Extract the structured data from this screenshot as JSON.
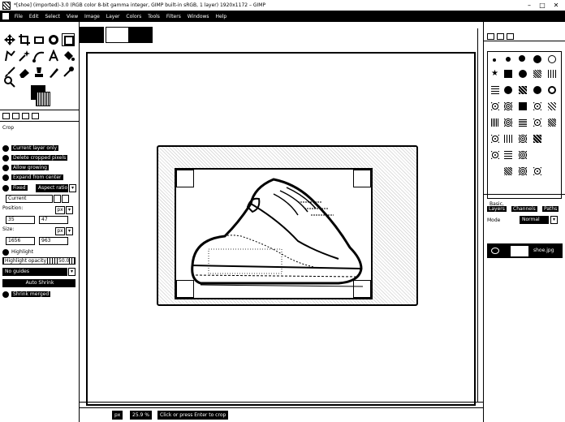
{
  "window": {
    "title": "*[shoe] (imported)-3.0 (RGB color 8-bit gamma integer, GIMP built-in sRGB, 1 layer) 1920x1172 – GIMP",
    "minimize": "–",
    "maximize": "□",
    "close": "✕"
  },
  "menu": [
    "File",
    "Edit",
    "Select",
    "View",
    "Image",
    "Layer",
    "Colors",
    "Tools",
    "Filters",
    "Windows",
    "Help"
  ],
  "tool_options": {
    "title": "Crop",
    "current_layer_only": "Current layer only",
    "delete_cropped": "Delete cropped pixels",
    "allow_growing": "Allow growing",
    "expand_from_center": "Expand from center",
    "fixed_label": "Fixed",
    "fixed_value": "Aspect ratio",
    "current_value": "Current",
    "position_label": "Position:",
    "position_x": "35",
    "position_y": "47",
    "position_unit": "px",
    "size_label": "Size:",
    "size_w": "1656",
    "size_h": "963",
    "size_unit": "px",
    "highlight_label": "Highlight",
    "highlight_opacity_label": "Highlight opacity",
    "highlight_opacity_value": "50.0",
    "guides_value": "No guides",
    "auto_shrink": "Auto Shrink",
    "shrink_merged": "Shrink merged"
  },
  "status": {
    "unit": "px",
    "zoom": "25.9 %",
    "message": "Click or press Enter to crop"
  },
  "right_dock": {
    "brushes_label": "Basic,",
    "layers_tabs": [
      "Layers",
      "Channels",
      "Paths"
    ],
    "mode_label": "Mode",
    "mode_value": "Normal",
    "layer_name": "shoe.jpg"
  }
}
